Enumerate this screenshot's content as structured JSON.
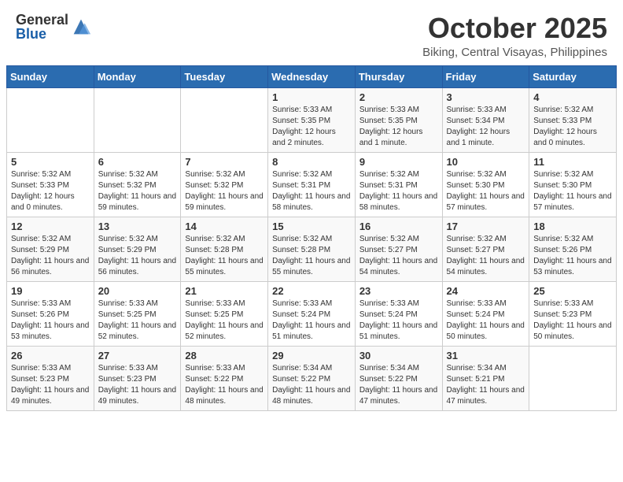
{
  "header": {
    "logo_general": "General",
    "logo_blue": "Blue",
    "month": "October 2025",
    "location": "Biking, Central Visayas, Philippines"
  },
  "weekdays": [
    "Sunday",
    "Monday",
    "Tuesday",
    "Wednesday",
    "Thursday",
    "Friday",
    "Saturday"
  ],
  "weeks": [
    [
      {
        "day": "",
        "sunrise": "",
        "sunset": "",
        "daylight": ""
      },
      {
        "day": "",
        "sunrise": "",
        "sunset": "",
        "daylight": ""
      },
      {
        "day": "",
        "sunrise": "",
        "sunset": "",
        "daylight": ""
      },
      {
        "day": "1",
        "sunrise": "Sunrise: 5:33 AM",
        "sunset": "Sunset: 5:35 PM",
        "daylight": "Daylight: 12 hours and 2 minutes."
      },
      {
        "day": "2",
        "sunrise": "Sunrise: 5:33 AM",
        "sunset": "Sunset: 5:35 PM",
        "daylight": "Daylight: 12 hours and 1 minute."
      },
      {
        "day": "3",
        "sunrise": "Sunrise: 5:33 AM",
        "sunset": "Sunset: 5:34 PM",
        "daylight": "Daylight: 12 hours and 1 minute."
      },
      {
        "day": "4",
        "sunrise": "Sunrise: 5:32 AM",
        "sunset": "Sunset: 5:33 PM",
        "daylight": "Daylight: 12 hours and 0 minutes."
      }
    ],
    [
      {
        "day": "5",
        "sunrise": "Sunrise: 5:32 AM",
        "sunset": "Sunset: 5:33 PM",
        "daylight": "Daylight: 12 hours and 0 minutes."
      },
      {
        "day": "6",
        "sunrise": "Sunrise: 5:32 AM",
        "sunset": "Sunset: 5:32 PM",
        "daylight": "Daylight: 11 hours and 59 minutes."
      },
      {
        "day": "7",
        "sunrise": "Sunrise: 5:32 AM",
        "sunset": "Sunset: 5:32 PM",
        "daylight": "Daylight: 11 hours and 59 minutes."
      },
      {
        "day": "8",
        "sunrise": "Sunrise: 5:32 AM",
        "sunset": "Sunset: 5:31 PM",
        "daylight": "Daylight: 11 hours and 58 minutes."
      },
      {
        "day": "9",
        "sunrise": "Sunrise: 5:32 AM",
        "sunset": "Sunset: 5:31 PM",
        "daylight": "Daylight: 11 hours and 58 minutes."
      },
      {
        "day": "10",
        "sunrise": "Sunrise: 5:32 AM",
        "sunset": "Sunset: 5:30 PM",
        "daylight": "Daylight: 11 hours and 57 minutes."
      },
      {
        "day": "11",
        "sunrise": "Sunrise: 5:32 AM",
        "sunset": "Sunset: 5:30 PM",
        "daylight": "Daylight: 11 hours and 57 minutes."
      }
    ],
    [
      {
        "day": "12",
        "sunrise": "Sunrise: 5:32 AM",
        "sunset": "Sunset: 5:29 PM",
        "daylight": "Daylight: 11 hours and 56 minutes."
      },
      {
        "day": "13",
        "sunrise": "Sunrise: 5:32 AM",
        "sunset": "Sunset: 5:29 PM",
        "daylight": "Daylight: 11 hours and 56 minutes."
      },
      {
        "day": "14",
        "sunrise": "Sunrise: 5:32 AM",
        "sunset": "Sunset: 5:28 PM",
        "daylight": "Daylight: 11 hours and 55 minutes."
      },
      {
        "day": "15",
        "sunrise": "Sunrise: 5:32 AM",
        "sunset": "Sunset: 5:28 PM",
        "daylight": "Daylight: 11 hours and 55 minutes."
      },
      {
        "day": "16",
        "sunrise": "Sunrise: 5:32 AM",
        "sunset": "Sunset: 5:27 PM",
        "daylight": "Daylight: 11 hours and 54 minutes."
      },
      {
        "day": "17",
        "sunrise": "Sunrise: 5:32 AM",
        "sunset": "Sunset: 5:27 PM",
        "daylight": "Daylight: 11 hours and 54 minutes."
      },
      {
        "day": "18",
        "sunrise": "Sunrise: 5:32 AM",
        "sunset": "Sunset: 5:26 PM",
        "daylight": "Daylight: 11 hours and 53 minutes."
      }
    ],
    [
      {
        "day": "19",
        "sunrise": "Sunrise: 5:33 AM",
        "sunset": "Sunset: 5:26 PM",
        "daylight": "Daylight: 11 hours and 53 minutes."
      },
      {
        "day": "20",
        "sunrise": "Sunrise: 5:33 AM",
        "sunset": "Sunset: 5:25 PM",
        "daylight": "Daylight: 11 hours and 52 minutes."
      },
      {
        "day": "21",
        "sunrise": "Sunrise: 5:33 AM",
        "sunset": "Sunset: 5:25 PM",
        "daylight": "Daylight: 11 hours and 52 minutes."
      },
      {
        "day": "22",
        "sunrise": "Sunrise: 5:33 AM",
        "sunset": "Sunset: 5:24 PM",
        "daylight": "Daylight: 11 hours and 51 minutes."
      },
      {
        "day": "23",
        "sunrise": "Sunrise: 5:33 AM",
        "sunset": "Sunset: 5:24 PM",
        "daylight": "Daylight: 11 hours and 51 minutes."
      },
      {
        "day": "24",
        "sunrise": "Sunrise: 5:33 AM",
        "sunset": "Sunset: 5:24 PM",
        "daylight": "Daylight: 11 hours and 50 minutes."
      },
      {
        "day": "25",
        "sunrise": "Sunrise: 5:33 AM",
        "sunset": "Sunset: 5:23 PM",
        "daylight": "Daylight: 11 hours and 50 minutes."
      }
    ],
    [
      {
        "day": "26",
        "sunrise": "Sunrise: 5:33 AM",
        "sunset": "Sunset: 5:23 PM",
        "daylight": "Daylight: 11 hours and 49 minutes."
      },
      {
        "day": "27",
        "sunrise": "Sunrise: 5:33 AM",
        "sunset": "Sunset: 5:23 PM",
        "daylight": "Daylight: 11 hours and 49 minutes."
      },
      {
        "day": "28",
        "sunrise": "Sunrise: 5:33 AM",
        "sunset": "Sunset: 5:22 PM",
        "daylight": "Daylight: 11 hours and 48 minutes."
      },
      {
        "day": "29",
        "sunrise": "Sunrise: 5:34 AM",
        "sunset": "Sunset: 5:22 PM",
        "daylight": "Daylight: 11 hours and 48 minutes."
      },
      {
        "day": "30",
        "sunrise": "Sunrise: 5:34 AM",
        "sunset": "Sunset: 5:22 PM",
        "daylight": "Daylight: 11 hours and 47 minutes."
      },
      {
        "day": "31",
        "sunrise": "Sunrise: 5:34 AM",
        "sunset": "Sunset: 5:21 PM",
        "daylight": "Daylight: 11 hours and 47 minutes."
      },
      {
        "day": "",
        "sunrise": "",
        "sunset": "",
        "daylight": ""
      }
    ]
  ]
}
